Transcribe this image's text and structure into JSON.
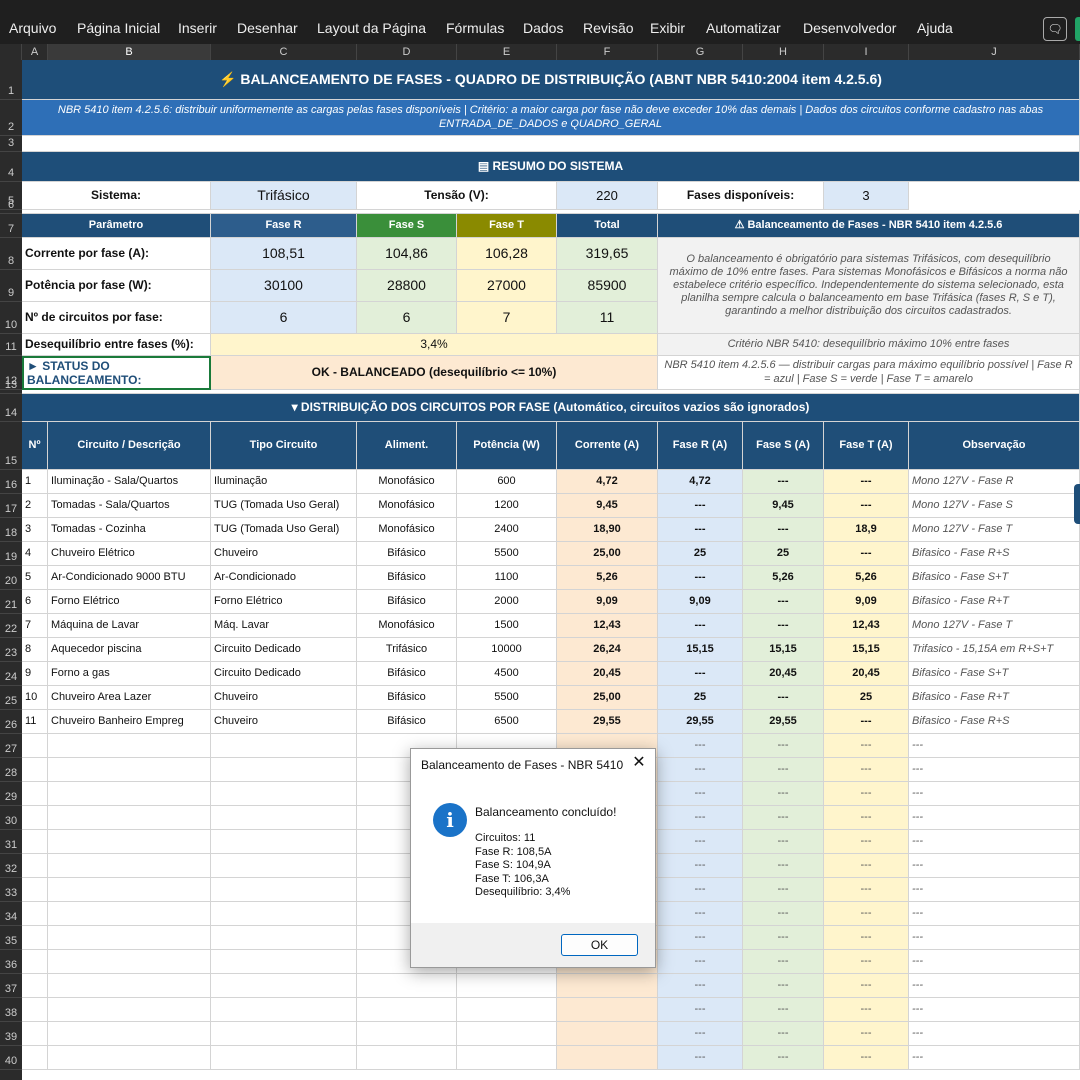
{
  "menu": [
    "Arquivo",
    "Página Inicial",
    "Inserir",
    "Desenhar",
    "Layout da Página",
    "Fórmulas",
    "Dados",
    "Revisão",
    "Exibir",
    "Automatizar",
    "Desenvolvedor",
    "Ajuda"
  ],
  "columns": [
    "A",
    "B",
    "C",
    "D",
    "E",
    "F",
    "G",
    "H",
    "I",
    "J"
  ],
  "title": "⚡  BALANCEAMENTO DE FASES - QUADRO DE DISTRIBUIÇÃO  (ABNT NBR 5410:2004 item 4.2.5.6)",
  "subtitle": "NBR 5410 item 4.2.5.6: distribuir uniformemente as cargas pelas fases disponíveis  |  Critério: a maior carga por fase não deve exceder 10% das demais  |  Dados dos circuitos conforme cadastro nas abas ENTRADA_DE_DADOS e QUADRO_GERAL",
  "resumo_title": "▤  RESUMO DO SISTEMA",
  "sistema": {
    "label": "Sistema:",
    "value": "Trifásico",
    "tensao_label": "Tensão (V):",
    "tensao_value": "220",
    "fases_label": "Fases disponíveis:",
    "fases_value": "3"
  },
  "summary_table": {
    "headers": [
      "Parâmetro",
      "Fase R",
      "Fase S",
      "Fase T",
      "Total"
    ],
    "rows": [
      [
        "Corrente por fase (A):",
        "108,51",
        "104,86",
        "106,28",
        "319,65"
      ],
      [
        "Potência por fase (W):",
        "30100",
        "28800",
        "27000",
        "85900"
      ],
      [
        "Nº de circuitos por fase:",
        "6",
        "6",
        "7",
        "11"
      ]
    ],
    "desequilibrio_label": "Desequilíbrio entre fases (%):",
    "desequilibrio_value": "3,4%",
    "status_label": "► STATUS DO BALANCEAMENTO:",
    "status_value": "OK - BALANCEADO (desequilíbrio <= 10%)"
  },
  "info_box": {
    "title": "⚠ Balanceamento de Fases - NBR 5410 item 4.2.5.6",
    "text": "O balanceamento é obrigatório para sistemas Trifásicos, com desequilíbrio máximo de 10% entre fases. Para sistemas Monofásicos e Bifásicos a norma não estabelece critério específico. Independentemente do sistema selecionado, esta planilha sempre calcula o balanceamento em base Trifásica (fases R, S e T), garantindo a melhor distribuição dos circuitos cadastrados.",
    "criterio": "Critério NBR 5410: desequilíbrio máximo 10% entre fases",
    "legend": "NBR 5410 item 4.2.5.6 — distribuir cargas para máximo equilíbrio possível  |  Fase R = azul  |  Fase S = verde  |  Fase T = amarelo"
  },
  "dist_title": "▾  DISTRIBUIÇÃO DOS CIRCUITOS POR FASE  (Automático, circuitos vazios são ignorados)",
  "dist_headers": [
    "Nº",
    "Circuito / Descrição",
    "Tipo Circuito",
    "Aliment.",
    "Potência (W)",
    "Corrente (A)",
    "Fase R (A)",
    "Fase S (A)",
    "Fase T (A)",
    "Observação"
  ],
  "circuits": [
    [
      "1",
      "Iluminação - Sala/Quartos",
      "Iluminação",
      "Monofásico",
      "600",
      "4,72",
      "4,72",
      "---",
      "---",
      "Mono 127V - Fase R"
    ],
    [
      "2",
      "Tomadas - Sala/Quartos",
      "TUG (Tomada Uso Geral)",
      "Monofásico",
      "1200",
      "9,45",
      "---",
      "9,45",
      "---",
      "Mono 127V - Fase S"
    ],
    [
      "3",
      "Tomadas - Cozinha",
      "TUG (Tomada Uso Geral)",
      "Monofásico",
      "2400",
      "18,90",
      "---",
      "---",
      "18,9",
      "Mono 127V - Fase T"
    ],
    [
      "4",
      "Chuveiro Elétrico",
      "Chuveiro",
      "Bifásico",
      "5500",
      "25,00",
      "25",
      "25",
      "---",
      "Bifasico - Fase R+S"
    ],
    [
      "5",
      "Ar-Condicionado 9000 BTU",
      "Ar-Condicionado",
      "Bifásico",
      "1100",
      "5,26",
      "---",
      "5,26",
      "5,26",
      "Bifasico - Fase S+T"
    ],
    [
      "6",
      "Forno Elétrico",
      "Forno Elétrico",
      "Bifásico",
      "2000",
      "9,09",
      "9,09",
      "---",
      "9,09",
      "Bifasico - Fase R+T"
    ],
    [
      "7",
      "Máquina de Lavar",
      "Máq. Lavar",
      "Monofásico",
      "1500",
      "12,43",
      "---",
      "---",
      "12,43",
      "Mono 127V - Fase T"
    ],
    [
      "8",
      "Aquecedor piscina",
      "Circuito Dedicado",
      "Trifásico",
      "10000",
      "26,24",
      "15,15",
      "15,15",
      "15,15",
      "Trifasico - 15,15A em R+S+T"
    ],
    [
      "9",
      "Forno a  gas",
      "Circuito Dedicado",
      "Bifásico",
      "4500",
      "20,45",
      "---",
      "20,45",
      "20,45",
      "Bifasico - Fase S+T"
    ],
    [
      "10",
      "Chuveiro Area Lazer",
      "Chuveiro",
      "Bifásico",
      "5500",
      "25,00",
      "25",
      "---",
      "25",
      "Bifasico - Fase R+T"
    ],
    [
      "11",
      "Chuveiro Banheiro Empreg",
      "Chuveiro",
      "Bifásico",
      "6500",
      "29,55",
      "29,55",
      "29,55",
      "---",
      "Bifasico - Fase R+S"
    ]
  ],
  "empty_placeholder": "---",
  "dialog": {
    "title": "Balanceamento de Fases - NBR 5410",
    "close": "✕",
    "icon": "i",
    "heading": "Balanceamento concluído!",
    "lines": [
      "Circuitos: 11",
      "Fase R: 108,5A",
      "Fase S: 104,9A",
      "Fase T: 106,3A",
      "Desequilíbrio: 3,4%"
    ],
    "ok": "OK"
  },
  "colors": {
    "header_blue": "#1f4e78",
    "phase_r": "#dbe8f7",
    "phase_s": "#e2efd9",
    "phase_t": "#fff5cc",
    "status_ok": "#fde9d2"
  }
}
